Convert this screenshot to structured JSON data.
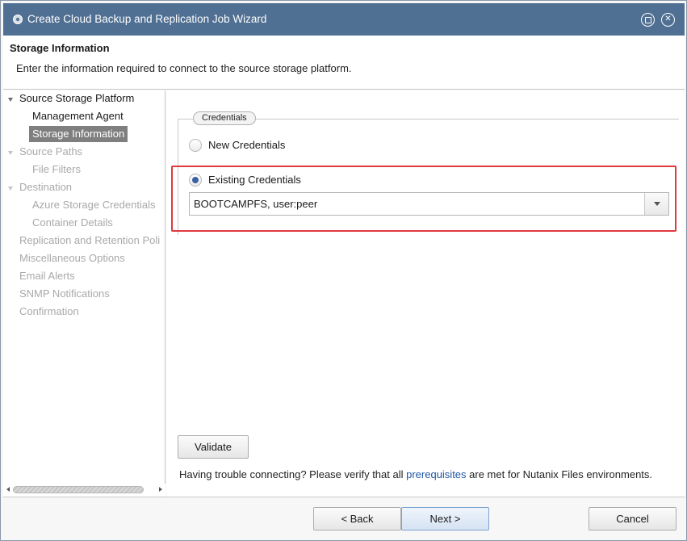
{
  "window": {
    "title": "Create Cloud Backup and Replication Job Wizard"
  },
  "header": {
    "step_title": "Storage Information",
    "step_description": "Enter the information required to connect to the source storage platform."
  },
  "nav": {
    "items": [
      {
        "label": "Source Storage Platform",
        "state": "active",
        "group": true
      },
      {
        "label": "Management Agent",
        "state": "active",
        "group": false
      },
      {
        "label": "Storage Information",
        "state": "selected",
        "group": false
      },
      {
        "label": "Source Paths",
        "state": "disabled",
        "group": true
      },
      {
        "label": "File Filters",
        "state": "disabled",
        "group": false
      },
      {
        "label": "Destination",
        "state": "disabled",
        "group": true
      },
      {
        "label": "Azure Storage Credentials",
        "state": "disabled",
        "group": false
      },
      {
        "label": "Container Details",
        "state": "disabled",
        "group": false
      },
      {
        "label": "Replication and Retention Poli",
        "state": "disabled",
        "group": false
      },
      {
        "label": "Miscellaneous Options",
        "state": "disabled",
        "group": false
      },
      {
        "label": "Email Alerts",
        "state": "disabled",
        "group": false
      },
      {
        "label": "SNMP Notifications",
        "state": "disabled",
        "group": false
      },
      {
        "label": "Confirmation",
        "state": "disabled",
        "group": false
      }
    ]
  },
  "credentials": {
    "legend": "Credentials",
    "options": [
      {
        "label": "New Credentials",
        "checked": false
      },
      {
        "label": "Existing Credentials",
        "checked": true
      }
    ],
    "selected_credential": "BOOTCAMPFS, user:peer"
  },
  "validate_label": "Validate",
  "trouble": {
    "prefix": "Having trouble connecting? Please verify that all ",
    "link": "prerequisites",
    "suffix": " are met for Nutanix Files environments."
  },
  "footer": {
    "back_label": "< Back",
    "next_label": "Next >",
    "cancel_label": "Cancel"
  },
  "colors": {
    "titlebar": "#4f6f93",
    "highlight": "#e0393e",
    "link": "#1f57a4",
    "radio_checked": "#3a62a3"
  }
}
